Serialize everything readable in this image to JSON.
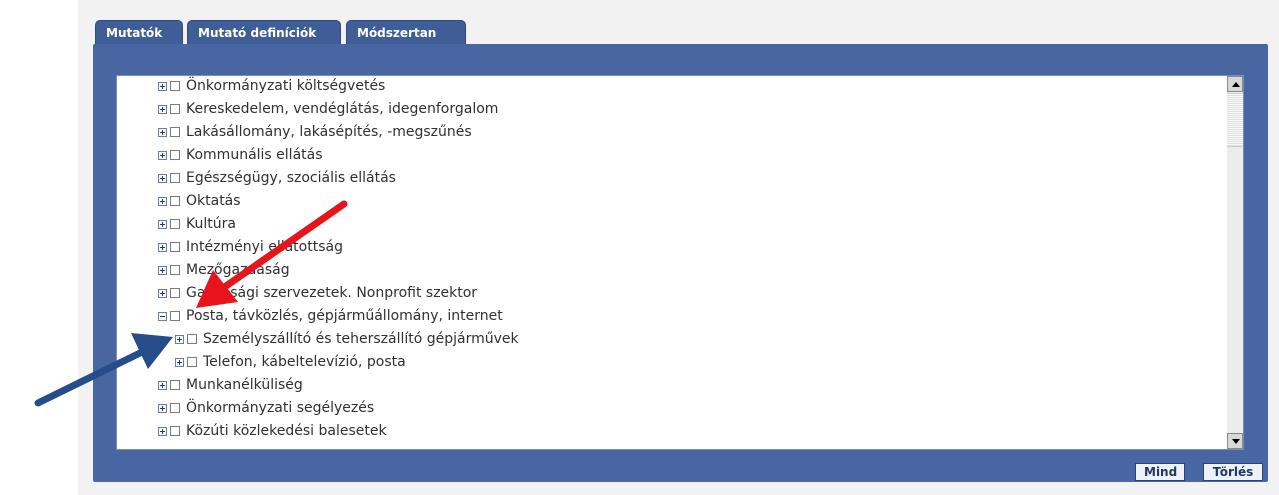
{
  "tabs": [
    {
      "label": "Mutatók"
    },
    {
      "label": "Mutató definíciók"
    },
    {
      "label": "Módszertan"
    }
  ],
  "tree": {
    "items": [
      {
        "label": "Önkormányzati költségvetés",
        "expanded": false,
        "level": 0,
        "checked": false
      },
      {
        "label": "Kereskedelem, vendéglátás, idegenforgalom",
        "expanded": false,
        "level": 0,
        "checked": false
      },
      {
        "label": "Lakásállomány, lakásépítés, -megszűnés",
        "expanded": false,
        "level": 0,
        "checked": false
      },
      {
        "label": "Kommunális ellátás",
        "expanded": false,
        "level": 0,
        "checked": false
      },
      {
        "label": "Egészségügy, szociális ellátás",
        "expanded": false,
        "level": 0,
        "checked": false
      },
      {
        "label": "Oktatás",
        "expanded": false,
        "level": 0,
        "checked": false
      },
      {
        "label": "Kultúra",
        "expanded": false,
        "level": 0,
        "checked": false
      },
      {
        "label": "Intézményi ellátottság",
        "expanded": false,
        "level": 0,
        "checked": false
      },
      {
        "label": "Mezőgazdaság",
        "expanded": false,
        "level": 0,
        "checked": false
      },
      {
        "label": "Gazdasági szervezetek. Nonprofit szektor",
        "expanded": false,
        "level": 0,
        "checked": false
      },
      {
        "label": "Posta, távközlés, gépjárműállomány, internet",
        "expanded": true,
        "level": 0,
        "checked": false
      },
      {
        "label": "Személyszállító és teherszállító gépjárművek",
        "expanded": false,
        "level": 1,
        "checked": false
      },
      {
        "label": "Telefon, kábeltelevízió, posta",
        "expanded": false,
        "level": 1,
        "checked": false
      },
      {
        "label": "Munkanélküliség",
        "expanded": false,
        "level": 0,
        "checked": false
      },
      {
        "label": "Önkormányzati segélyezés",
        "expanded": false,
        "level": 0,
        "checked": false
      },
      {
        "label": "Közúti közlekedési balesetek",
        "expanded": false,
        "level": 0,
        "checked": false
      }
    ]
  },
  "buttons": {
    "all_label": "Mind",
    "clear_label": "Törlés"
  },
  "colors": {
    "panel": "#4766a2",
    "tab": "#3f5e98",
    "red_arrow": "#e8141b",
    "blue_arrow": "#254d8a"
  }
}
